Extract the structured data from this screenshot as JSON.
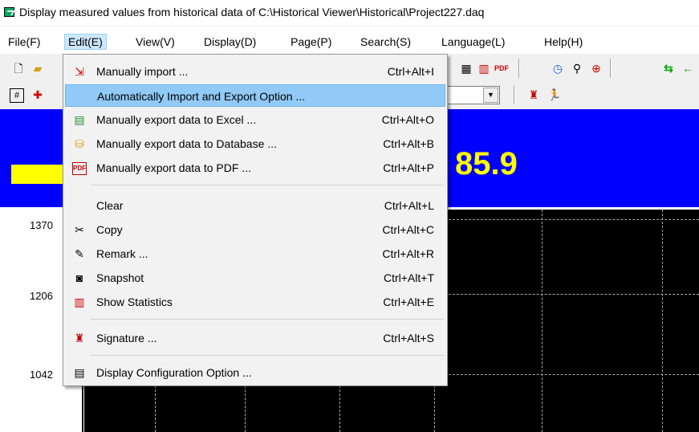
{
  "window": {
    "title": "Display measured values from historical data of C:\\Historical Viewer\\Historical\\Project227.daq"
  },
  "menubar": {
    "items": [
      {
        "label": "File(F)"
      },
      {
        "label": "Edit(E)"
      },
      {
        "label": "View(V)"
      },
      {
        "label": "Display(D)"
      },
      {
        "label": "Page(P)"
      },
      {
        "label": "Search(S)"
      },
      {
        "label": "Language(L)"
      },
      {
        "label": "Help(H)"
      }
    ]
  },
  "display": {
    "readout": "85.9",
    "y_ticks": [
      "1370",
      "1206",
      "1042"
    ]
  },
  "edit_menu": {
    "items": [
      {
        "label": "Manually import ...",
        "shortcut": "Ctrl+Alt+I",
        "icon": "import-icon"
      },
      {
        "label": "Automatically Import and Export Option ...",
        "shortcut": "",
        "icon": ""
      },
      {
        "label": "Manually export data to Excel ...",
        "shortcut": "Ctrl+Alt+O",
        "icon": "excel-export-icon"
      },
      {
        "label": "Manually export data to Database ...",
        "shortcut": "Ctrl+Alt+B",
        "icon": "database-export-icon"
      },
      {
        "label": "Manually export data to PDF ...",
        "shortcut": "Ctrl+Alt+P",
        "icon": "pdf-export-icon"
      },
      {
        "label": "Clear",
        "shortcut": "Ctrl+Alt+L",
        "icon": ""
      },
      {
        "label": "Copy",
        "shortcut": "Ctrl+Alt+C",
        "icon": "scissors-icon"
      },
      {
        "label": "Remark ...",
        "shortcut": "Ctrl+Alt+R",
        "icon": "remark-icon"
      },
      {
        "label": "Snapshot",
        "shortcut": "Ctrl+Alt+T",
        "icon": "camera-icon"
      },
      {
        "label": "Show Statistics",
        "shortcut": "Ctrl+Alt+E",
        "icon": "statistics-icon"
      },
      {
        "label": "Signature ...",
        "shortcut": "Ctrl+Alt+S",
        "icon": "signature-icon"
      },
      {
        "label": "Display Configuration Option ...",
        "shortcut": "",
        "icon": "config-icon"
      }
    ]
  },
  "colors": {
    "banner": "#0000ff",
    "readout": "#ffff00",
    "menu_highlight": "#91c9f7"
  }
}
